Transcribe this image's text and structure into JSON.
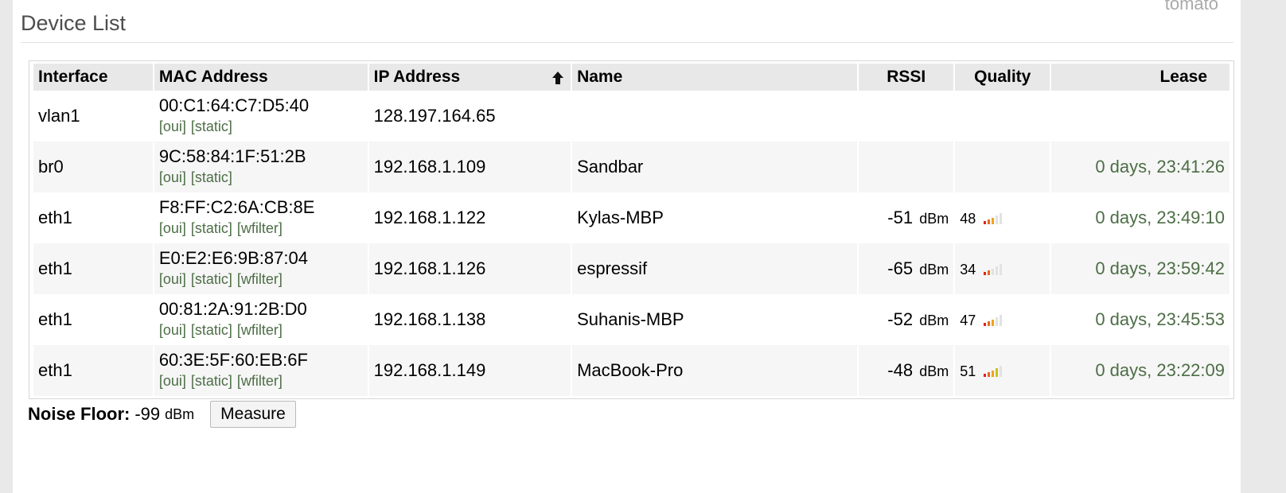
{
  "brand": "tomato",
  "title": "Device List",
  "columns": {
    "interface": "Interface",
    "mac": "MAC Address",
    "ip": "IP Address",
    "name": "Name",
    "rssi": "RSSI",
    "quality": "Quality",
    "lease": "Lease"
  },
  "sorted_column": "ip",
  "sort_direction": "ascending",
  "rssi_unit": "dBm",
  "quality_levels_max": 5,
  "rows": [
    {
      "interface": "vlan1",
      "mac": "00:C1:64:C7:D5:40",
      "links": [
        "[oui]",
        "[static]"
      ],
      "ip": "128.197.164.65",
      "name": "",
      "rssi": "",
      "quality": "",
      "quality_bars": 0,
      "lease": ""
    },
    {
      "interface": "br0",
      "mac": "9C:58:84:1F:51:2B",
      "links": [
        "[oui]",
        "[static]"
      ],
      "ip": "192.168.1.109",
      "name": "Sandbar",
      "rssi": "",
      "quality": "",
      "quality_bars": 0,
      "lease": "0 days, 23:41:26"
    },
    {
      "interface": "eth1",
      "mac": "F8:FF:C2:6A:CB:8E",
      "links": [
        "[oui]",
        "[static]",
        "[wfilter]"
      ],
      "ip": "192.168.1.122",
      "name": "Kylas-MBP",
      "rssi": "-51",
      "quality": "48",
      "quality_bars": 3,
      "lease": "0 days, 23:49:10"
    },
    {
      "interface": "eth1",
      "mac": "E0:E2:E6:9B:87:04",
      "links": [
        "[oui]",
        "[static]",
        "[wfilter]"
      ],
      "ip": "192.168.1.126",
      "name": "espressif",
      "rssi": "-65",
      "quality": "34",
      "quality_bars": 2,
      "lease": "0 days, 23:59:42"
    },
    {
      "interface": "eth1",
      "mac": "00:81:2A:91:2B:D0",
      "links": [
        "[oui]",
        "[static]",
        "[wfilter]"
      ],
      "ip": "192.168.1.138",
      "name": "Suhanis-MBP",
      "rssi": "-52",
      "quality": "47",
      "quality_bars": 3,
      "lease": "0 days, 23:45:53"
    },
    {
      "interface": "eth1",
      "mac": "60:3E:5F:60:EB:6F",
      "links": [
        "[oui]",
        "[static]",
        "[wfilter]"
      ],
      "ip": "192.168.1.149",
      "name": "MacBook-Pro",
      "rssi": "-48",
      "quality": "51",
      "quality_bars": 4,
      "lease": "0 days, 23:22:09"
    }
  ],
  "noise_floor": {
    "label": "Noise Floor:",
    "value": "-99",
    "unit": "dBm"
  },
  "measure_button": "Measure",
  "colors": {
    "link_green": "#4d6e46",
    "header_bg": "#e8e8e8",
    "row_alt_bg": "#f6f6f6",
    "title_gray": "#4d4d4d"
  }
}
